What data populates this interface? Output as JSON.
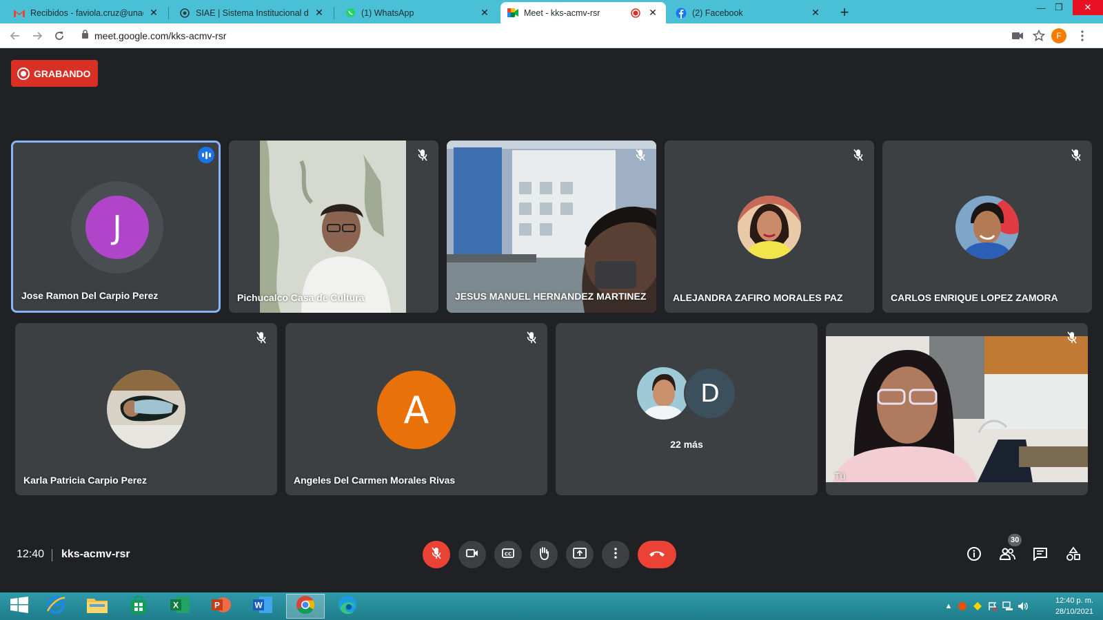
{
  "browser": {
    "tabs": [
      {
        "title": "Recibidos - faviola.cruz@unach.m",
        "icon": "gmail-icon",
        "active": false
      },
      {
        "title": "SIAE | Sistema Institucional de Ac",
        "icon": "siae-icon",
        "active": false
      },
      {
        "title": "(1) WhatsApp",
        "icon": "whatsapp-icon",
        "active": false
      },
      {
        "title": "Meet - kks-acmv-rsr",
        "icon": "meet-icon",
        "active": true
      },
      {
        "title": "(2) Facebook",
        "icon": "facebook-icon",
        "active": false
      }
    ],
    "new_tab": "+",
    "url": "meet.google.com/kks-acmv-rsr",
    "profile_initial": "F"
  },
  "meet": {
    "recording_label": "GRABANDO",
    "participants_row1": [
      {
        "name": "Jose Ramon Del Carpio Perez",
        "kind": "initial",
        "initial": "J",
        "speaking": true
      },
      {
        "name": "Pichucalco Casa de Cultura",
        "kind": "video",
        "speaking": false
      },
      {
        "name": "JESUS MANUEL HERNANDEZ MARTINEZ",
        "kind": "video",
        "speaking": false
      },
      {
        "name": "ALEJANDRA ZAFIRO MORALES PAZ",
        "kind": "photo",
        "speaking": false
      },
      {
        "name": "CARLOS ENRIQUE LOPEZ ZAMORA",
        "kind": "photo",
        "speaking": false
      }
    ],
    "participants_row2": [
      {
        "name": "Karla Patricia Carpio Perez",
        "kind": "photo"
      },
      {
        "name": "Angeles Del Carmen Morales Rivas",
        "kind": "initial",
        "initial": "A"
      },
      {
        "name": "",
        "kind": "more",
        "more_initial": "D",
        "more_label": "22 más"
      },
      {
        "name": "Tú",
        "kind": "self-video"
      }
    ],
    "time": "12:40",
    "meeting_code": "kks-acmv-rsr",
    "people_count": "30"
  },
  "taskbar": {
    "apps": [
      "windows-start",
      "internet-explorer",
      "file-explorer",
      "store",
      "excel",
      "powerpoint",
      "word",
      "chrome",
      "edge"
    ],
    "clock_time": "12:40 p. m.",
    "clock_date": "28/10/2021"
  },
  "colors": {
    "tabbar": "#49c0d5",
    "meet_bg": "#202124",
    "tile_bg": "#3c4043",
    "record_red": "#d93025",
    "speaking_blue": "#1a73e8",
    "avatar_j": "#b045c9",
    "avatar_a": "#e8710a"
  }
}
